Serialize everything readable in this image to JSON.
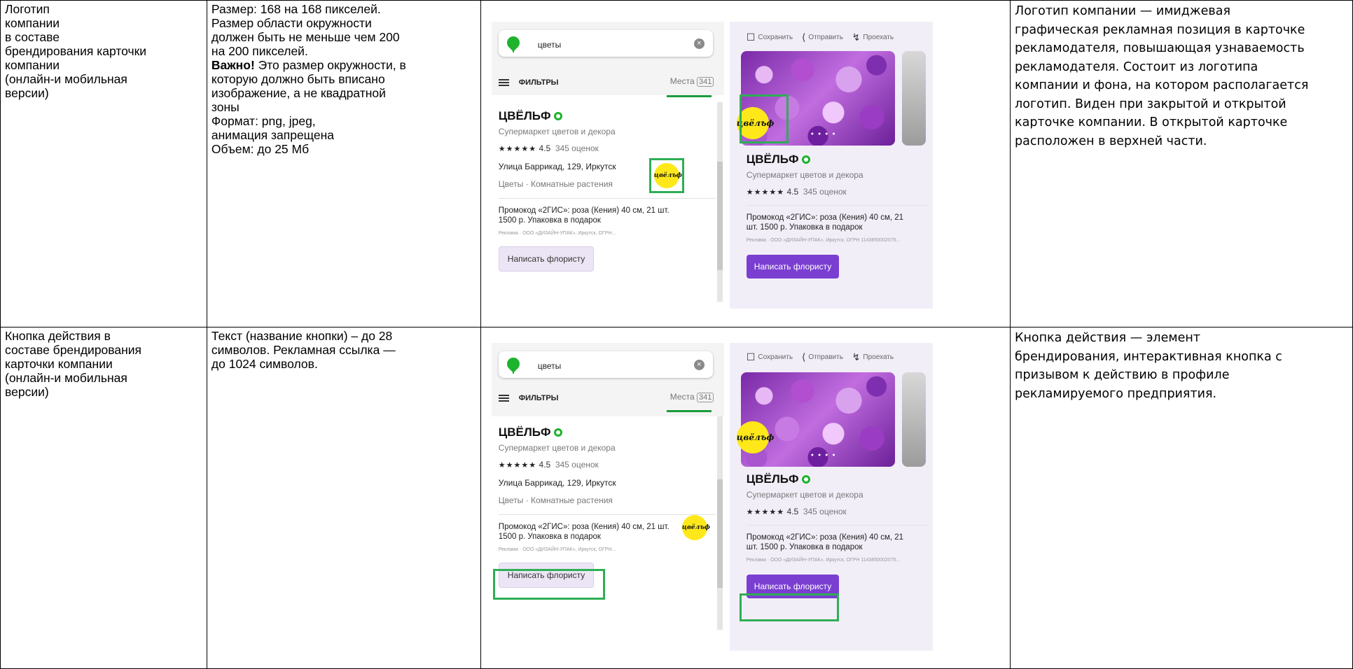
{
  "rows": [
    {
      "element": [
        "Логотип",
        "компании",
        "в составе",
        "брендирования карточки",
        "компании",
        "(онлайн-и мобильная",
        "версии)"
      ],
      "requirements": [
        {
          "text": "Размер: 168 на 168 пикселей."
        },
        {
          "text": "Размер области окружности"
        },
        {
          "text": "должен быть не меньше чем 200"
        },
        {
          "text": "на 200 пикселей."
        },
        {
          "bold": "Важно!",
          "text": " Это размер окружности, в"
        },
        {
          "text": "которую должно быть вписано"
        },
        {
          "text": "изображение, а не квадратной"
        },
        {
          "text": "зоны"
        },
        {
          "text": "Формат: png, jpeg,"
        },
        {
          "text": "анимация запрещена"
        },
        {
          "text": "Объем: до 25 Мб"
        }
      ],
      "description": [
        "Логотип компании — имиджевая",
        "графическая рекламная позиция в карточке",
        "рекламодателя, повышающая  узнаваемость",
        "рекламодателя. Состоит из логотипа",
        "компании и фона, на котором располагается",
        "логотип. Виден при закрытой и открытой",
        "карточке компании. В открытой карточке",
        "расположен в верхней части."
      ]
    },
    {
      "element": [
        "Кнопка действия в",
        "составе брендирования",
        "карточки компании",
        "(онлайн-и мобильная",
        "версии)"
      ],
      "requirements": [
        {
          "text": "Текст (название кнопки) – до 28"
        },
        {
          "text": "символов. Рекламная ссылка —"
        },
        {
          "text": "до 1024 символов."
        }
      ],
      "description": [
        "Кнопка действия — элемент",
        "брендирования, интерактивная кнопка с",
        "призывом к действию в профиле",
        "рекламируемого предприятия."
      ]
    }
  ],
  "mockup": {
    "search_query": "цветы",
    "filters_label": "ФИЛЬТРЫ",
    "places_label": "Места",
    "places_count": "341",
    "save_label": "Сохранить",
    "share_label": "Отправить",
    "route_label": "Проехать",
    "company_name": "ЦВЁЛЬФ",
    "company_subtitle": "Супермаркет цветов и декора",
    "stars": "★★★★★",
    "rating": "4.5",
    "reviews": "345 оценок",
    "address": "Улица Баррикад, 129, Иркутск",
    "categories": "Цветы · Комнатные растения",
    "promo_left": "Промокод «2ГИС»: роза (Кения) 40 см, 21 шт. 1500 р. Упаковка в подарок",
    "legal_left": "Реклама · ООО «ДИЗАЙН-УПАК», Иркутск, ОГРН...",
    "promo_right": "Промокод «2ГИС»: роза (Кения) 40 см, 21 шт. 1500 р. Упаковка в подарок",
    "legal_right": "Реклама · ООО «ДИЗАЙН-УПАК», Иркутск, ОГРН 1143850002075...",
    "action_button": "Написать флористу",
    "logo_text": "цвёлъф",
    "highlight_color": "#2eae55",
    "accent_color": "#7a3fd1"
  }
}
